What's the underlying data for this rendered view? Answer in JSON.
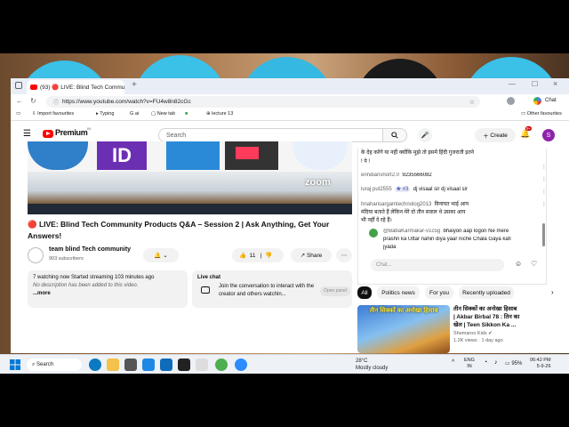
{
  "browser": {
    "tab_title": "(93) 🔴 LIVE: Blind Tech Communi",
    "url": "https://www.youtube.com/watch?v=FU4w8n82cGc",
    "profile_label": "Chat"
  },
  "bookmarks": {
    "items": [
      "Import favourites",
      "Typing",
      "ai",
      "New tab",
      "lecture 13"
    ],
    "other": "Other favourites"
  },
  "youtube": {
    "logo_text": "Premium",
    "logo_sup": "IN",
    "search_placeholder": "Search",
    "create_label": "Create",
    "notif_count": "9+",
    "avatar_letter": "S"
  },
  "video": {
    "title": "🔴 LIVE: Blind Tech Community Products Q&A – Session 2 | Ask Anything, Get Your Answers!",
    "zoom_label": "zoom",
    "channel_name": "team blind Tech community",
    "subscribers": "903 subscribers",
    "like_count": "11",
    "share_label": "Share"
  },
  "description": {
    "stats": "7 watching now  Started streaming 103 minutes ago",
    "empty": "No description has been added to this video.",
    "more": "...more"
  },
  "livechat_box": {
    "title": "Live chat",
    "text": "Join the conversation to interact with the creator and others watchin...",
    "button": "Open panel"
  },
  "chat": {
    "messages": [
      {
        "text": "के देह करेगे या नहीं क्योंकि मुझे तो इसमें हिंदी गुजराती इतने"
      },
      {
        "text": "! पे !"
      },
      {
        "author": "erindianshort2.0",
        "text": "9235566082"
      },
      {
        "author": "luraj put2555",
        "badge": "#3",
        "text": "dj visaal sir dj visaal sir"
      },
      {
        "author": "hnaharisargamtechnolog2013",
        "text": "विनायत भाई आप"
      },
      {
        "text": "मंदिया बताते हैं लेकिन मेरे दो तीन सवाल थे उसका आप"
      },
      {
        "text": "भी नहीं दे रहे हैं।"
      },
      {
        "author": "@BabaKarmakar-v1c5g",
        "text": "bhaiyon aap logon Ne mere"
      },
      {
        "text": "prashn ka Uttar nahin diya yaar niche Chala Gaya kafi"
      },
      {
        "text": "jyada"
      }
    ],
    "input_placeholder": "Chat..."
  },
  "chips": [
    "All",
    "Politics news",
    "For you",
    "Recently uploaded"
  ],
  "recommendation": {
    "thumb_text": "तीन सिक्कों का अनोखा हिसाब",
    "title_line1": "तीन सिक्कों का अनोखा हिसाब",
    "title_line2": "| Akbar Birbal 78 : तिन का",
    "title_line3": "खेल | Teen Sikkon Ka ...",
    "channel": "Shemaroo Kids",
    "meta": "1.2K views · 1 day ago"
  },
  "taskbar": {
    "search_label": "Search",
    "weather_temp": "28°C",
    "weather_desc": "Mostly cloudy",
    "lang": "ENG",
    "lang2": "IN",
    "battery": "95%",
    "time": "06:42 PM",
    "date": "5-9-26"
  },
  "colors": {
    "youtube_red": "#ff0000",
    "accent_blue": "#065fd4"
  }
}
